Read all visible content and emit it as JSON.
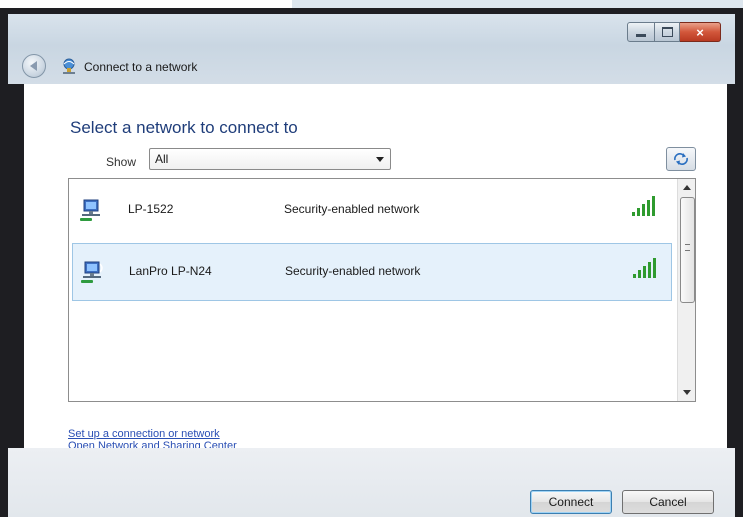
{
  "window": {
    "title": "Connect to a network",
    "buttons": {
      "minimize": "minimize",
      "maximize": "maximize",
      "close": "×"
    }
  },
  "main": {
    "heading": "Select a network to connect to",
    "show": {
      "label": "Show",
      "selected": "All"
    }
  },
  "networks": [
    {
      "ssid": "LP-1522",
      "security": "Security-enabled network",
      "icon": "wireless-network-icon",
      "signal": "signal-strength-icon"
    },
    {
      "ssid": "LanPro LP-N24",
      "security": "Security-enabled network",
      "icon": "wireless-network-icon",
      "signal": "signal-strength-icon"
    }
  ],
  "links": {
    "setup": "Set up a connection or network",
    "sharing_center": "Open Network and Sharing Center"
  },
  "buttons": {
    "connect": "Connect",
    "cancel": "Cancel"
  },
  "colors": {
    "heading": "#1f3d7a",
    "link": "#2a4fb4",
    "signal": "#2f9b2f",
    "selected_row": "#e5f1fb"
  }
}
